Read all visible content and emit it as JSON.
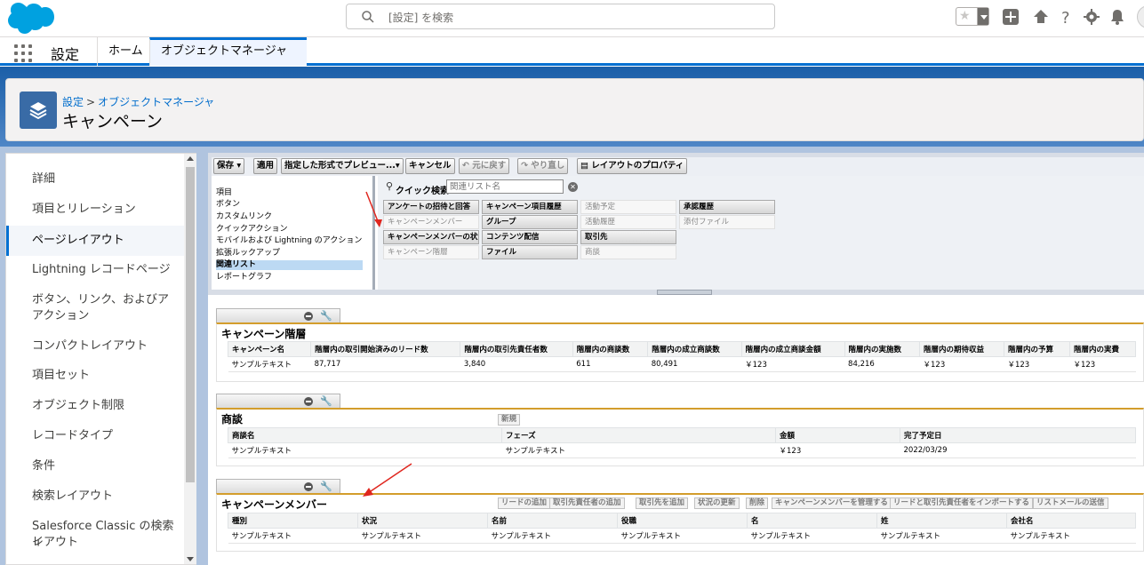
{
  "topbar": {
    "search_placeholder": "[設定] を検索"
  },
  "nav": {
    "app_name": "設定",
    "tabs": [
      {
        "label": "ホーム"
      },
      {
        "label": "オブジェクトマネージャ"
      }
    ]
  },
  "header": {
    "breadcrumb_root": "設定",
    "breadcrumb_sep": ">",
    "breadcrumb_child": "オブジェクトマネージャ",
    "title": "キャンペーン"
  },
  "sidebar": {
    "items": [
      {
        "label": "詳細"
      },
      {
        "label": "項目とリレーション"
      },
      {
        "label": "ページレイアウト"
      },
      {
        "label": "Lightning レコードページ"
      },
      {
        "label": "ボタン、リンク、およびア"
      },
      {
        "label": "アクション"
      },
      {
        "label": "コンパクトレイアウト"
      },
      {
        "label": "項目セット"
      },
      {
        "label": "オブジェクト制限"
      },
      {
        "label": "レコードタイプ"
      },
      {
        "label": "条件"
      },
      {
        "label": "検索レイアウト"
      },
      {
        "label": "Salesforce Classic の検索レ"
      },
      {
        "label": "イアウト"
      }
    ]
  },
  "toolbar": {
    "save": "保存",
    "apply": "適用",
    "preview": "指定した形式でプレビュー...",
    "cancel": "キャンセル",
    "undo": "元に戻す",
    "redo": "やり直し",
    "layout_props": "レイアウトのプロパティ"
  },
  "palette": {
    "categories": [
      "項目",
      "ボタン",
      "カスタムリンク",
      "クイックアクション",
      "モバイルおよび Lightning のアクション",
      "拡張ルックアップ",
      "関連リスト",
      "レポートグラフ"
    ],
    "quick_search_label": "クイック検索",
    "quick_search_placeholder": "関連リスト名",
    "items": [
      [
        "アンケートの招待と回答",
        "キャンペーン項目履歴",
        "活動予定",
        "承認履歴"
      ],
      [
        "キャンペーンメンバー",
        "グループ",
        "活動履歴",
        "添付ファイル"
      ],
      [
        "キャンペーンメンバーの状況",
        "コンテンツ配信",
        "取引先",
        ""
      ],
      [
        "キャンペーン階層",
        "ファイル",
        "商談",
        ""
      ]
    ]
  },
  "sections": {
    "hierarchy": {
      "title": "キャンペーン階層",
      "columns": [
        "キャンペーン名",
        "階層内の取引開始済みのリード数",
        "階層内の取引先責任者数",
        "階層内の商談数",
        "階層内の成立商談数",
        "階層内の成立商談金額",
        "階層内の実施数",
        "階層内の期待収益",
        "階層内の予算",
        "階層内の実費"
      ],
      "row": [
        "サンプルテキスト",
        "87,717",
        "3,840",
        "611",
        "80,491",
        "￥123",
        "84,216",
        "￥123",
        "￥123",
        "￥123"
      ]
    },
    "opportunity": {
      "title": "商談",
      "new_button": "新規",
      "columns": [
        "商談名",
        "フェーズ",
        "金額",
        "完了予定日"
      ],
      "row": [
        "サンプルテキスト",
        "サンプルテキスト",
        "￥123",
        "2022/03/29"
      ]
    },
    "members": {
      "title": "キャンペーンメンバー",
      "buttons": [
        "リードの追加",
        "取引先責任者の追加",
        "取引先を追加",
        "状況の更新",
        "削除",
        "キャンペーンメンバーを管理する",
        "リードと取引先責任者をインポートする",
        "リストメールの送信"
      ],
      "columns": [
        "種別",
        "状況",
        "名前",
        "役職",
        "名",
        "姓",
        "会社名"
      ],
      "row": [
        "サンプルテキスト",
        "サンプルテキスト",
        "サンプルテキスト",
        "サンプルテキスト",
        "サンプルテキスト",
        "サンプルテキスト",
        "サンプルテキスト"
      ]
    }
  },
  "colors": {
    "brand": "#00a1e0",
    "accent": "#0070d2",
    "section_rule": "#d39d2c",
    "arrow": "#e0271f"
  }
}
